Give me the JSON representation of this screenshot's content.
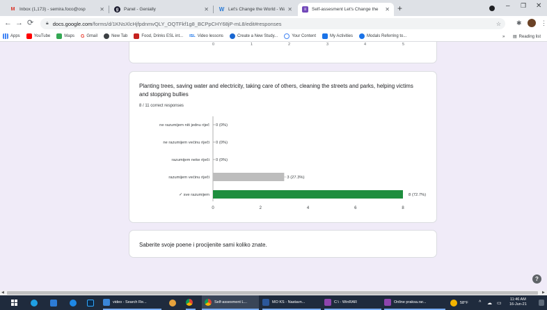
{
  "browser": {
    "tabs": [
      {
        "title": "Inbox (1,173) - semira.foco@osp",
        "icon_color": "#d93025",
        "icon": "gmail-icon",
        "active": false
      },
      {
        "title": "Panel - Genially",
        "icon_color": "#1a1a2e",
        "icon": "genially-icon",
        "active": false
      },
      {
        "title": "Let's Change the World - Wakele",
        "icon_color": "#2b7bd6",
        "icon": "wakelet-icon",
        "active": false
      },
      {
        "title": "Self-assesment Let's Change the",
        "icon_color": "#7248b9",
        "icon": "forms-icon",
        "active": true
      }
    ],
    "new_tab": "+",
    "url_host": "docs.google.com",
    "url_path": "/forms/d/1KNsXlcHjfpdnmvQLY_OQTFkf1g8_BCPpCHY68jP-mL8/edit#responses",
    "bookmarks": [
      {
        "label": "Apps",
        "color": "#4285f4"
      },
      {
        "label": "YouTube",
        "color": "#ff0000"
      },
      {
        "label": "Maps",
        "color": "#34a853"
      },
      {
        "label": "Gmail",
        "color": "#ea4335"
      },
      {
        "label": "New Tab",
        "color": "#3c4043"
      },
      {
        "label": "Food, Drinks ESL int...",
        "color": "#c5221f"
      },
      {
        "label": "Video lessons",
        "color": "#1a73e8"
      },
      {
        "label": "Create a New Study...",
        "color": "#1967d2"
      },
      {
        "label": "Your Content",
        "color": "#4285f4"
      },
      {
        "label": "My Activities",
        "color": "#1a73e8"
      },
      {
        "label": "Modals Referring to...",
        "color": "#1a73e8"
      }
    ],
    "bookmarks_more": "»",
    "reading_list": "Reading list"
  },
  "prev_chart_ticks": [
    "0",
    "1",
    "2",
    "3",
    "4",
    "5"
  ],
  "question": {
    "title": "Planting trees, saving water and electricity, taking care of others, cleaning the streets and parks, helping victims and stopping bullies",
    "correct_responses": "8 / 11 correct responses"
  },
  "chart_data": {
    "type": "bar",
    "orientation": "horizontal",
    "categories": [
      "ne razumijem niti jednu riječ",
      "ne razumijem većinu riječi",
      "razumijem neke riječi",
      "razumijem većinu riječi",
      "✓ sve razumijem"
    ],
    "values": [
      0,
      0,
      0,
      3,
      8
    ],
    "data_labels": [
      "0 (0%)",
      "0 (0%)",
      "0 (0%)",
      "3 (27.3%)",
      "8 (72.7%)"
    ],
    "colors": [
      "#bdbdbd",
      "#bdbdbd",
      "#bdbdbd",
      "#bdbdbd",
      "#1e8e3e"
    ],
    "x_ticks": [
      0,
      2,
      4,
      6,
      8
    ],
    "xlim": [
      0,
      8
    ],
    "grid": false,
    "title": "",
    "xlabel": "",
    "ylabel": ""
  },
  "next_card": {
    "text": "Saberite svoje poene i procijenite sami koliko znate."
  },
  "help_label": "?",
  "taskbar": {
    "items": [
      {
        "label": "",
        "icon": "windows-start-icon",
        "color": "#ffffff"
      },
      {
        "label": "",
        "icon": "edge-icon",
        "color": "#1fa0e3"
      },
      {
        "label": "",
        "icon": "store-icon",
        "color": "#2d7cd6"
      },
      {
        "label": "",
        "icon": "teams-icon",
        "color": "#5b5fc7"
      },
      {
        "label": "",
        "icon": "photoshop-icon",
        "color": "#0a2a4a"
      },
      {
        "label": "video - Search Re...",
        "icon": "file-explorer-icon",
        "color": "#3a86d9"
      },
      {
        "label": "",
        "icon": "paint-icon",
        "color": "#e6a23c"
      },
      {
        "label": "",
        "icon": "chrome-icon",
        "color": "#db4437"
      },
      {
        "label": "Self-assesment L...",
        "icon": "chrome-icon",
        "color": "#db4437"
      },
      {
        "label": "MO KS - Nastavn...",
        "icon": "word-icon",
        "color": "#2b579a"
      },
      {
        "label": "C:\\ - WinRAR",
        "icon": "winrar-icon",
        "color": "#8e44ad"
      },
      {
        "label": "Online praksa.rar...",
        "icon": "winrar-icon",
        "color": "#8e44ad"
      }
    ],
    "weather": "58°F",
    "time": "11:46 AM",
    "date": "16-Jun-21"
  }
}
